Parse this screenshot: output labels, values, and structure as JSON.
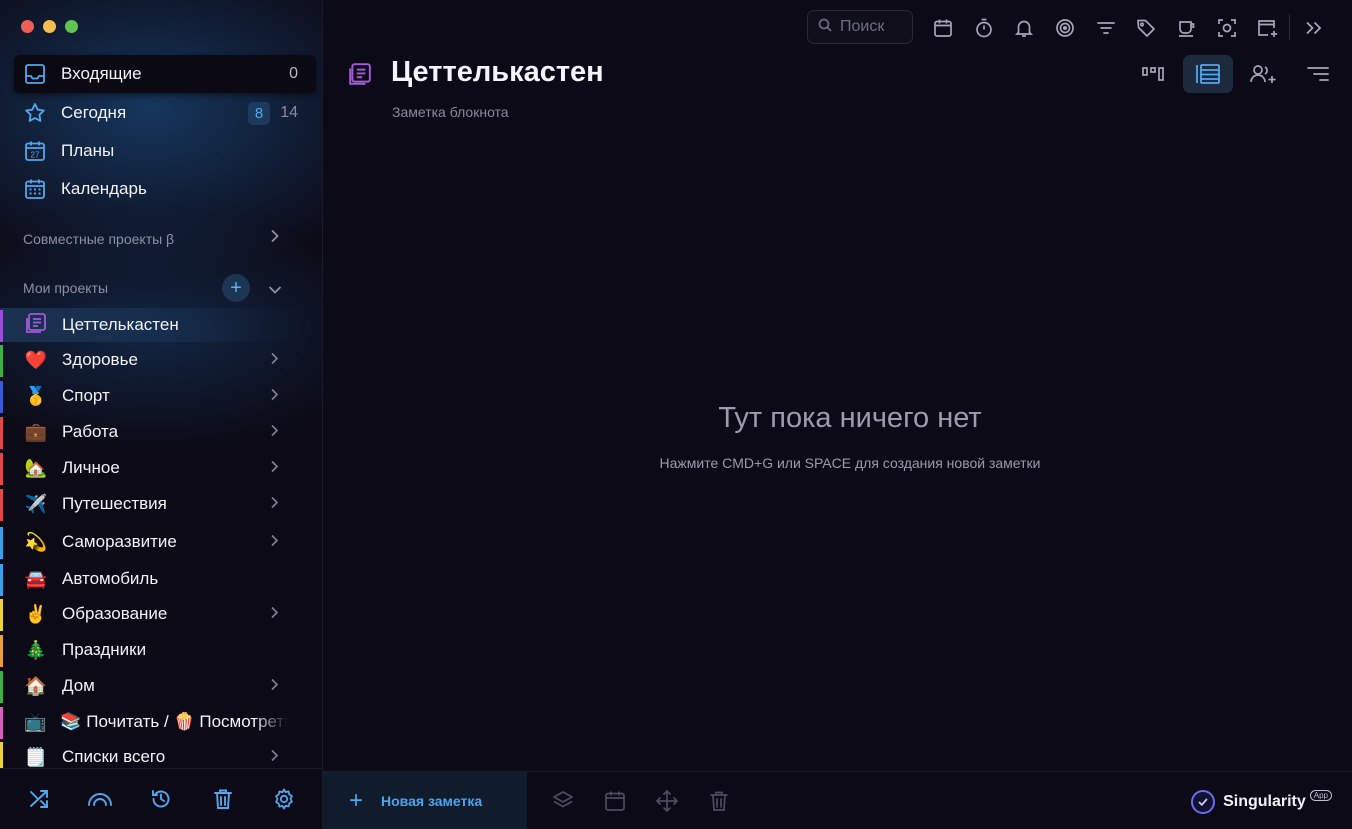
{
  "window": {
    "controls": [
      "close",
      "minimize",
      "zoom"
    ]
  },
  "sidebar": {
    "nav": [
      {
        "label": "Входящие",
        "count": "0",
        "icon": "inbox-icon"
      },
      {
        "label": "Сегодня",
        "badge": "8",
        "count": "14",
        "icon": "star-icon"
      },
      {
        "label": "Планы",
        "icon": "calendar-27-icon",
        "icon_text": "27"
      },
      {
        "label": "Календарь",
        "icon": "calendar-grid-icon"
      }
    ],
    "shared_projects_label": "Совместные проекты β",
    "my_projects_label": "Мои проекты",
    "add_symbol": "+",
    "projects": [
      {
        "label": "Цеттелькастен",
        "emoji": "",
        "color": "#9b4fd6",
        "has_children": false,
        "active": true
      },
      {
        "label": "Здоровье",
        "emoji": "❤️",
        "color": "#3fae4a",
        "has_children": true
      },
      {
        "label": "Спорт",
        "emoji": "🥇",
        "color": "#3b5bd6",
        "has_children": true
      },
      {
        "label": "Работа",
        "emoji": "💼",
        "color": "#e04848",
        "has_children": true
      },
      {
        "label": "Личное",
        "emoji": "🏡",
        "color": "#e04848",
        "has_children": true
      },
      {
        "label": "Путешествия",
        "emoji": "✈️",
        "color": "#e04848",
        "has_children": true
      },
      {
        "label": "Саморазвитие",
        "emoji": "💫",
        "color": "#3aa0e8",
        "has_children": true
      },
      {
        "label": "Автомобиль",
        "emoji": "🚘",
        "color": "#3aa0e8",
        "has_children": false
      },
      {
        "label": "Образование",
        "emoji": "✌️",
        "color": "#e8d43a",
        "has_children": true
      },
      {
        "label": "Праздники",
        "emoji": "🎄",
        "color": "#e8a03a",
        "has_children": false
      },
      {
        "label": "Дом",
        "emoji": "🏠",
        "color": "#3fae4a",
        "has_children": true
      },
      {
        "label": "📚 Почитать / 🍿 Посмотреть",
        "emoji": "📺",
        "color": "#d65fbf",
        "has_children": false
      },
      {
        "label": "Списки всего",
        "emoji": "🗒️",
        "color": "#e8d43a",
        "has_children": true
      }
    ],
    "footer": [
      "shuffle-icon",
      "signal-arc-icon",
      "history-icon",
      "trash-icon",
      "settings-gear-icon"
    ]
  },
  "topbar": {
    "search_placeholder": "Поиск",
    "tools": [
      "calendar-icon",
      "timer-icon",
      "bell-icon",
      "target-icon",
      "filter-icon",
      "tag-icon",
      "cup-icon",
      "focus-icon",
      "add-window-icon"
    ],
    "collapse_icon": "double-chevron-right-icon"
  },
  "page": {
    "title": "Цеттелькастен",
    "subtitle": "Заметка блокнота",
    "view_buttons": [
      "board-view-icon",
      "list-view-icon",
      "assign-user-icon",
      "sort-icon"
    ],
    "active_view": 1
  },
  "empty_state": {
    "title": "Тут пока ничего нет",
    "hint": "Нажмите CMD+G или SPACE для создания новой заметки"
  },
  "footer": {
    "new_note_symbol": "+",
    "new_note_label": "Новая заметка",
    "tools": [
      "layers-icon",
      "calendar-icon",
      "move-icon",
      "trash-icon"
    ],
    "brand_name": "Singularity",
    "brand_tag": "App"
  },
  "colors": {
    "accent": "#4aa5f0",
    "background": "#0c0a16",
    "active_project": "#9b4fd6"
  }
}
